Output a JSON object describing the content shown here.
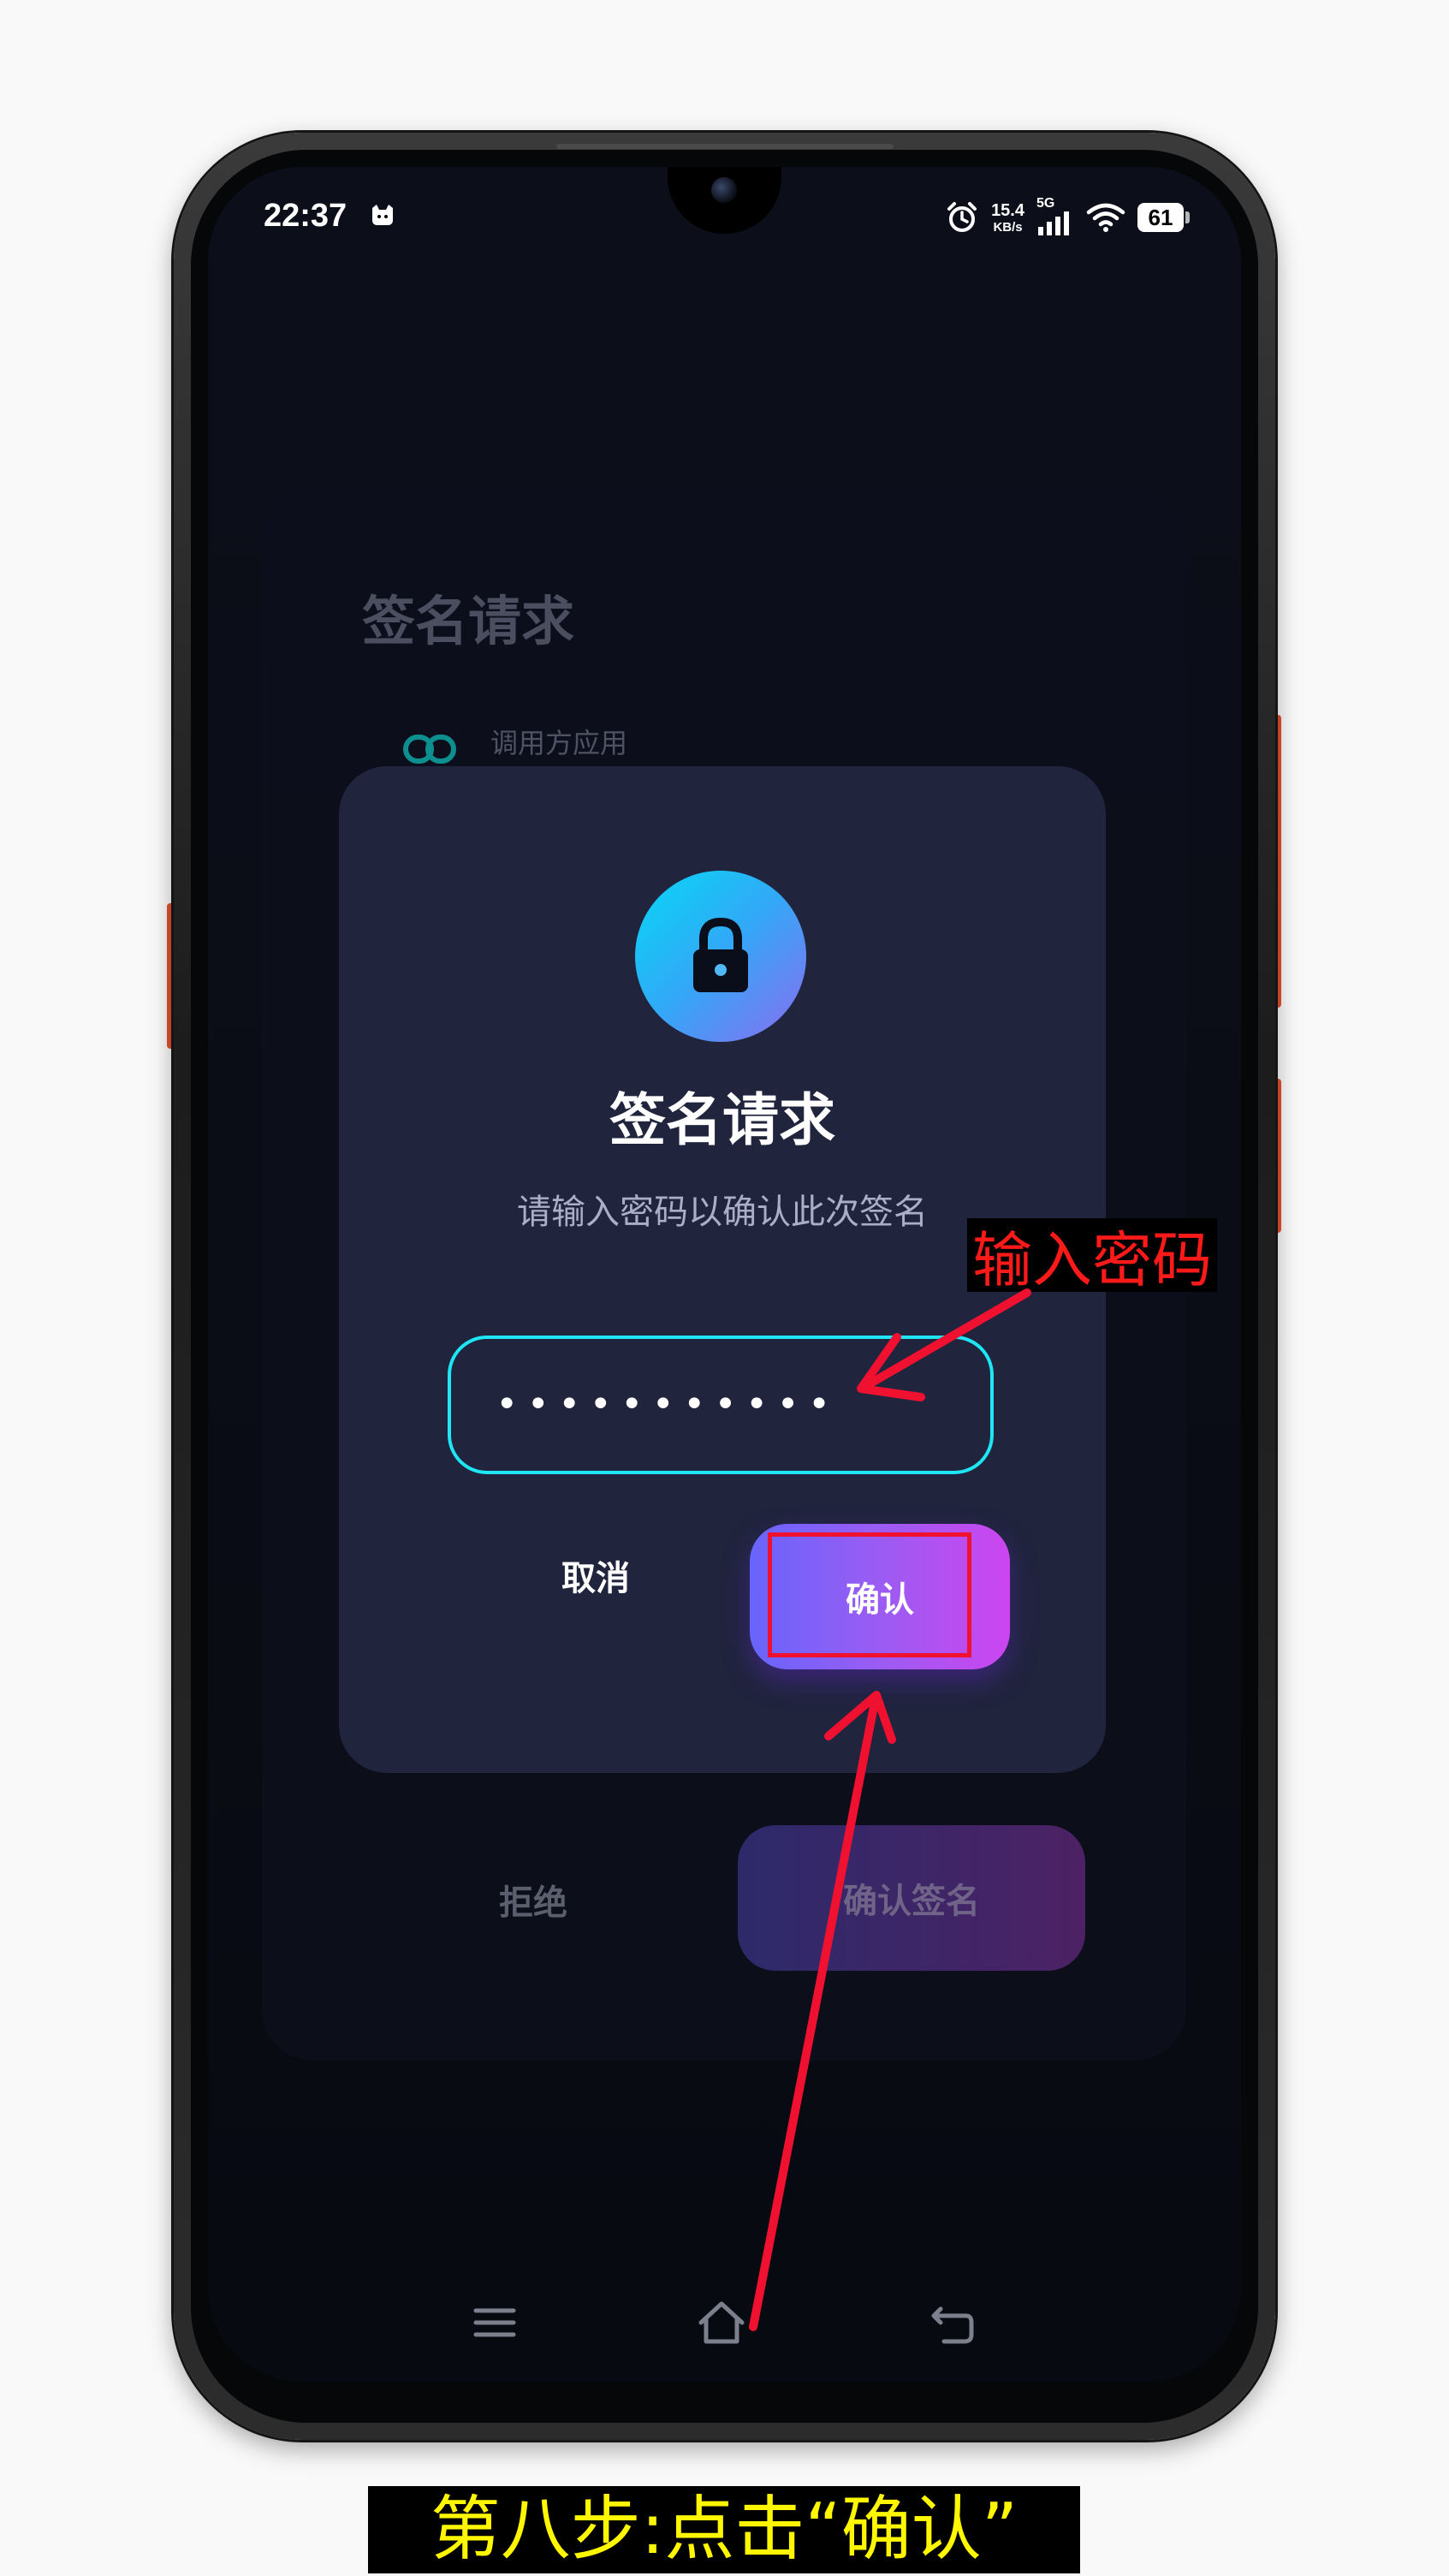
{
  "status_bar": {
    "time": "22:37",
    "app_icon": "cat-icon",
    "alarm_icon": "alarm-icon",
    "net_speed_value": "15.4",
    "net_speed_unit": "KB/s",
    "network_label": "5G",
    "wifi_icon": "wifi-icon",
    "battery_level": "61"
  },
  "background_page": {
    "title": "签名请求",
    "caller_label": "调用方应用",
    "caller_icon": "link-icon",
    "reject_label": "拒绝",
    "confirm_label": "确认签名"
  },
  "modal": {
    "lock_icon": "lock-icon",
    "title": "签名请求",
    "subtitle": "请输入密码以确认此次签名",
    "password_value": "•••••••••••",
    "cancel_label": "取消",
    "confirm_label": "确认"
  },
  "nav_bar": {
    "menu_icon": "menu-icon",
    "home_icon": "home-icon",
    "back_icon": "back-icon"
  },
  "annotations": {
    "input_label": "输入密码",
    "caption": "第八步:点击“确认”"
  },
  "colors": {
    "accent_cyan": "#1ee6f5",
    "button_gradient_start": "#6865fb",
    "button_gradient_end": "#cc45ef",
    "annotation_red": "#f01030",
    "caption_yellow": "#fff700"
  }
}
